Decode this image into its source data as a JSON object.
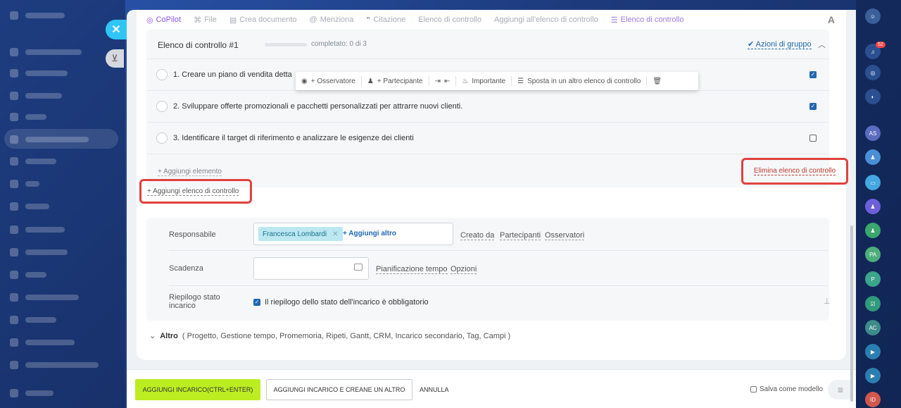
{
  "toolbar": {
    "copilot": "CoPilot",
    "file": "File",
    "crea_documento": "Crea documento",
    "menziona": "Menziona",
    "citazione": "Citazione",
    "elenco": "Elenco di controllo",
    "aggiungi_elenco": "Aggiungi all'elenco di controllo",
    "elenco_active": "Elenco di controllo",
    "font_a": "A"
  },
  "checklist": {
    "title": "Elenco di controllo #1",
    "progress": "completato: 0 di 3",
    "progress_fraction": 0,
    "group_actions": "Azioni di gruppo",
    "items": [
      {
        "num": "1.",
        "text": "Creare un piano di vendita detta",
        "checked": true
      },
      {
        "num": "2.",
        "text": "Sviluppare offerte promozionali e pacchetti personalizzati per attrarre nuovi clienti.",
        "checked": true
      },
      {
        "num": "3.",
        "text": "Identificare il target di riferimento e analizzare le esigenze dei clienti",
        "checked": false
      }
    ],
    "add_item": "+ Aggiungi elemento",
    "delete": "Elimina elenco di controllo",
    "add_checklist": "+ Aggiungi elenco di controllo"
  },
  "popup": {
    "observer": "+ Osservatore",
    "participant": "+ Partecipante",
    "important": "Importante",
    "move": "Sposta in un altro elenco di controllo"
  },
  "fields": {
    "responsabile_label": "Responsabile",
    "responsabile_tag": "Francesca Lombardi",
    "add_more": "+ Aggiungi altro",
    "creato_da": "Creato da",
    "partecipanti": "Partecipanti",
    "osservatori": "Osservatori",
    "scadenza_label": "Scadenza",
    "pianificazione": "Pianificazione tempo",
    "opzioni": "Opzioni",
    "riepilogo_label_1": "Riepilogo stato",
    "riepilogo_label_2": "incarico",
    "riepilogo_text": "Il riepilogo dello stato dell'incarico è obbligatorio"
  },
  "altro": {
    "label": "Altro",
    "list": "( Progetto,  Gestione tempo,  Promemoria,  Ripeti,  Gantt,  CRM,  Incarico secondario,  Tag,  Campi )"
  },
  "footer": {
    "add": "AGGIUNGI INCARICO(CTRL+ENTER)",
    "add_another": "AGGIUNGI INCARICO E CREANE UN ALTRO",
    "cancel": "ANNULLA",
    "save_template": "Salva come modello"
  },
  "right_rail": {
    "notif_count": "52",
    "avatars": [
      "AS",
      "PA",
      "P",
      "AC",
      "ID"
    ]
  },
  "colors": {
    "accent": "#2067b0",
    "primary_button": "#bbed21",
    "highlight_border": "#e0423e"
  }
}
